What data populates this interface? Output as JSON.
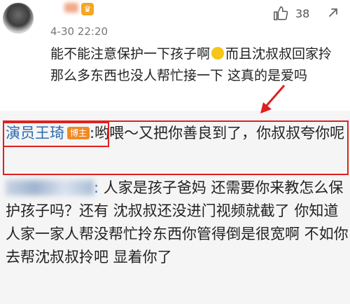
{
  "comment": {
    "time": "4-30 22:20",
    "likes": "38",
    "text_part1": "能不能注意保护一下孩子啊",
    "text_part2": "而且沈叔叔回家拎那么多东西也没人帮忙接一下 这真的是爱吗"
  },
  "reply1": {
    "author": "演员王琦",
    "badge": "博主",
    "text": ":哟喂～又把你善良到了，你叔叔夸你呢"
  },
  "reply2": {
    "colon": ":",
    "text": " 人家是孩子爸妈 还需要你来教怎么保护孩子吗？还有 沈叔叔还没进门视频就截了 你知道人家一家人帮没帮忙拎东西你管得倒是很宽啊 不如你去帮沈叔叔拎吧 显着你了"
  },
  "icons": {
    "like": "thumbs-up-icon",
    "more": "share-icon",
    "vip": "crown-icon",
    "emoji": "sad-face-icon"
  },
  "colors": {
    "author_link": "#2a6ab0",
    "highlight_red": "#e0201e",
    "badge_orange": "#f08a24"
  }
}
